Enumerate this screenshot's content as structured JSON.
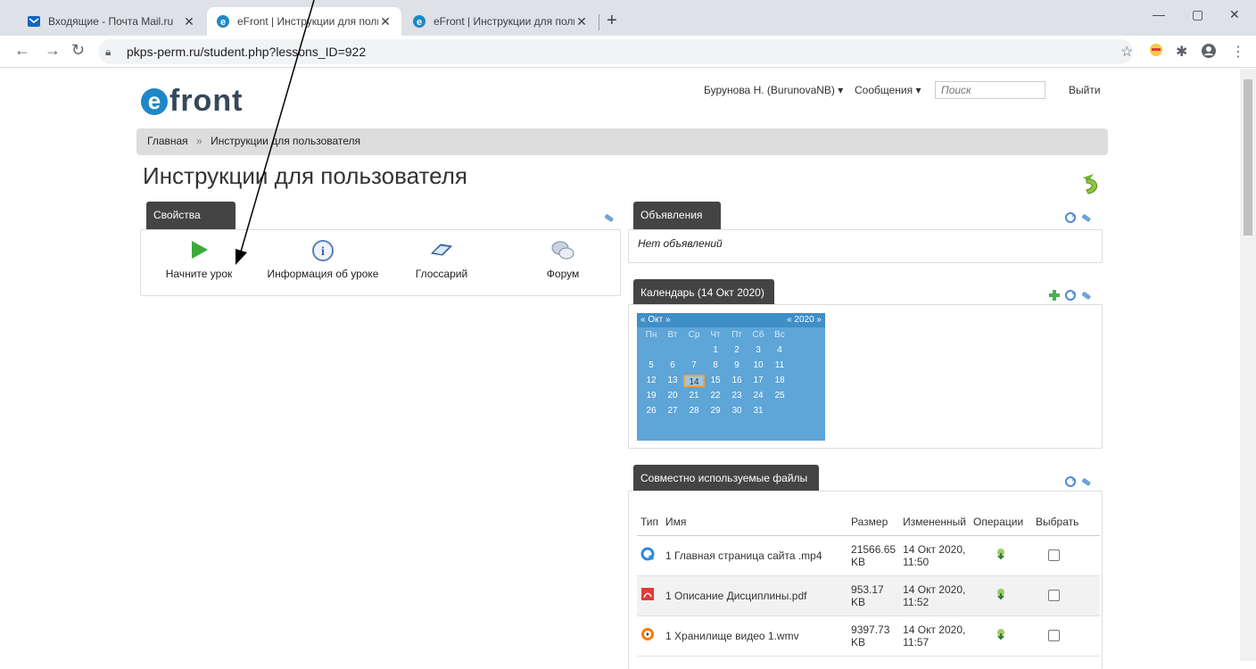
{
  "browser": {
    "tabs": [
      {
        "title": "Входящие - Почта Mail.ru",
        "active": false
      },
      {
        "title": "eFront | Инструкции для пользо",
        "active": true
      },
      {
        "title": "eFront | Инструкции для пользо",
        "active": false
      }
    ],
    "url": "pkps-perm.ru/student.php?lessons_ID=922"
  },
  "header": {
    "logo_text": "front",
    "user": "Бурунова Н. (BurunovaNB) ▾",
    "messages": "Сообщения ▾",
    "search_placeholder": "Поиск",
    "logout": "Выйти"
  },
  "breadcrumb": {
    "home": "Главная",
    "separator": "»",
    "current": "Инструкции для пользователя"
  },
  "page_title": "Инструкции для пользователя",
  "properties": {
    "title": "Свойства",
    "items": [
      {
        "label": "Начните урок",
        "icon": "play-icon"
      },
      {
        "label": "Информация об уроке",
        "icon": "info-icon"
      },
      {
        "label": "Глоссарий",
        "icon": "book-icon"
      },
      {
        "label": "Форум",
        "icon": "forum-icon"
      }
    ]
  },
  "announcements": {
    "title": "Объявления",
    "empty_text": "Нет объявлений"
  },
  "calendar": {
    "title": "Календарь (14 Окт 2020)",
    "month": "Окт",
    "year": "2020",
    "weekdays": [
      "Пн",
      "Вт",
      "Ср",
      "Чт",
      "Пт",
      "Сб",
      "Вс"
    ],
    "today": "14",
    "leading_blanks": 3,
    "days": [
      "1",
      "2",
      "3",
      "4",
      "5",
      "6",
      "7",
      "8",
      "9",
      "10",
      "11",
      "12",
      "13",
      "14",
      "15",
      "16",
      "17",
      "18",
      "19",
      "20",
      "21",
      "22",
      "23",
      "24",
      "25",
      "26",
      "27",
      "28",
      "29",
      "30",
      "31"
    ]
  },
  "files": {
    "title": "Совместно используемые файлы",
    "columns": [
      "Тип",
      "Имя",
      "Размер",
      "Измененный",
      "Операции",
      "Выбрать"
    ],
    "rows": [
      {
        "type_icon": "video-file-icon",
        "name": "1 Главная страница сайта .mp4",
        "size": "21566.65 KB",
        "modified": "14 Окт 2020, 11:50"
      },
      {
        "type_icon": "pdf-file-icon",
        "name": "1 Описание Дисциплины.pdf",
        "size": "953.17 KB",
        "modified": "14 Окт 2020, 11:52"
      },
      {
        "type_icon": "media-file-icon",
        "name": "1 Хранилище видео 1.wmv",
        "size": "9397.73 KB",
        "modified": "14 Окт 2020, 11:57"
      }
    ]
  },
  "colors": {
    "accent": "#1e88c7",
    "tab_header": "#444444",
    "calendar": "#5ea5d8",
    "today_border": "#f4a23b"
  }
}
